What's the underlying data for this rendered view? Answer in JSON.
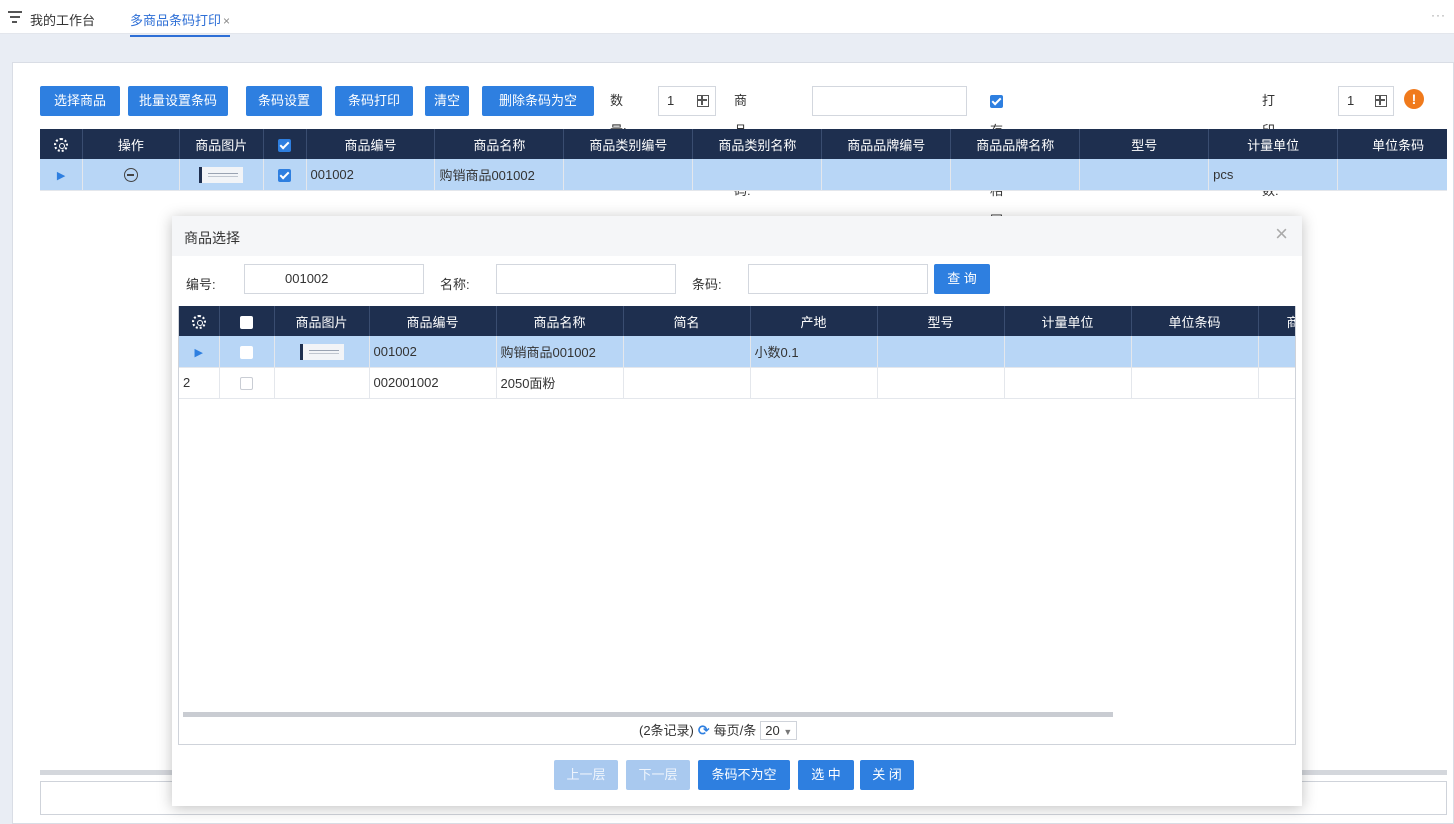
{
  "topbar": {
    "home_label": "我的工作台",
    "active_tab": "多商品条码打印",
    "close": "×",
    "more": "···"
  },
  "toolbar": {
    "buttons": [
      "选择商品",
      "批量设置条码",
      "条码设置",
      "条码打印",
      "清空",
      "删除条码为空"
    ],
    "qty_label": "数量:",
    "qty_value": "1",
    "barcode_label": "商品条码:",
    "barcode_value": "",
    "accumulate_label": "存在相同商品累加打印份数",
    "accumulate_checked": true,
    "copies_label": "打印份数:",
    "copies_value": "1",
    "warn": "!"
  },
  "main_table": {
    "headers": [
      "操作",
      "商品图片",
      "商品编号",
      "商品名称",
      "商品类别编号",
      "商品类别名称",
      "商品品牌编号",
      "商品品牌名称",
      "型号",
      "计量单位",
      "单位条码"
    ],
    "row": {
      "code": "001002",
      "name": "购销商品001002",
      "unit": "pcs"
    }
  },
  "modal": {
    "title": "商品选择",
    "close": "×",
    "filter": {
      "code_label": "编号:",
      "code_value": "001002",
      "name_label": "名称:",
      "name_value": "",
      "barcode_label": "条码:",
      "barcode_value": "",
      "query_button": "查 询"
    },
    "headers": [
      "商品图片",
      "商品编号",
      "商品名称",
      "简名",
      "产地",
      "型号",
      "计量单位",
      "单位条码",
      "商"
    ],
    "rows": [
      {
        "index": "",
        "code": "001002",
        "name": "购销商品001002",
        "short": "",
        "origin": "小数0.1"
      },
      {
        "index": "2",
        "code": "002001002",
        "name": "2050面粉",
        "short": "",
        "origin": ""
      }
    ],
    "pager": {
      "records": "(2条记录)",
      "per_page_label": "每页/条",
      "page_size": "20"
    },
    "buttons": {
      "prev": "上一层",
      "next": "下一层",
      "not_empty": "条码不为空",
      "select": "选 中",
      "close": "关 闭"
    }
  }
}
